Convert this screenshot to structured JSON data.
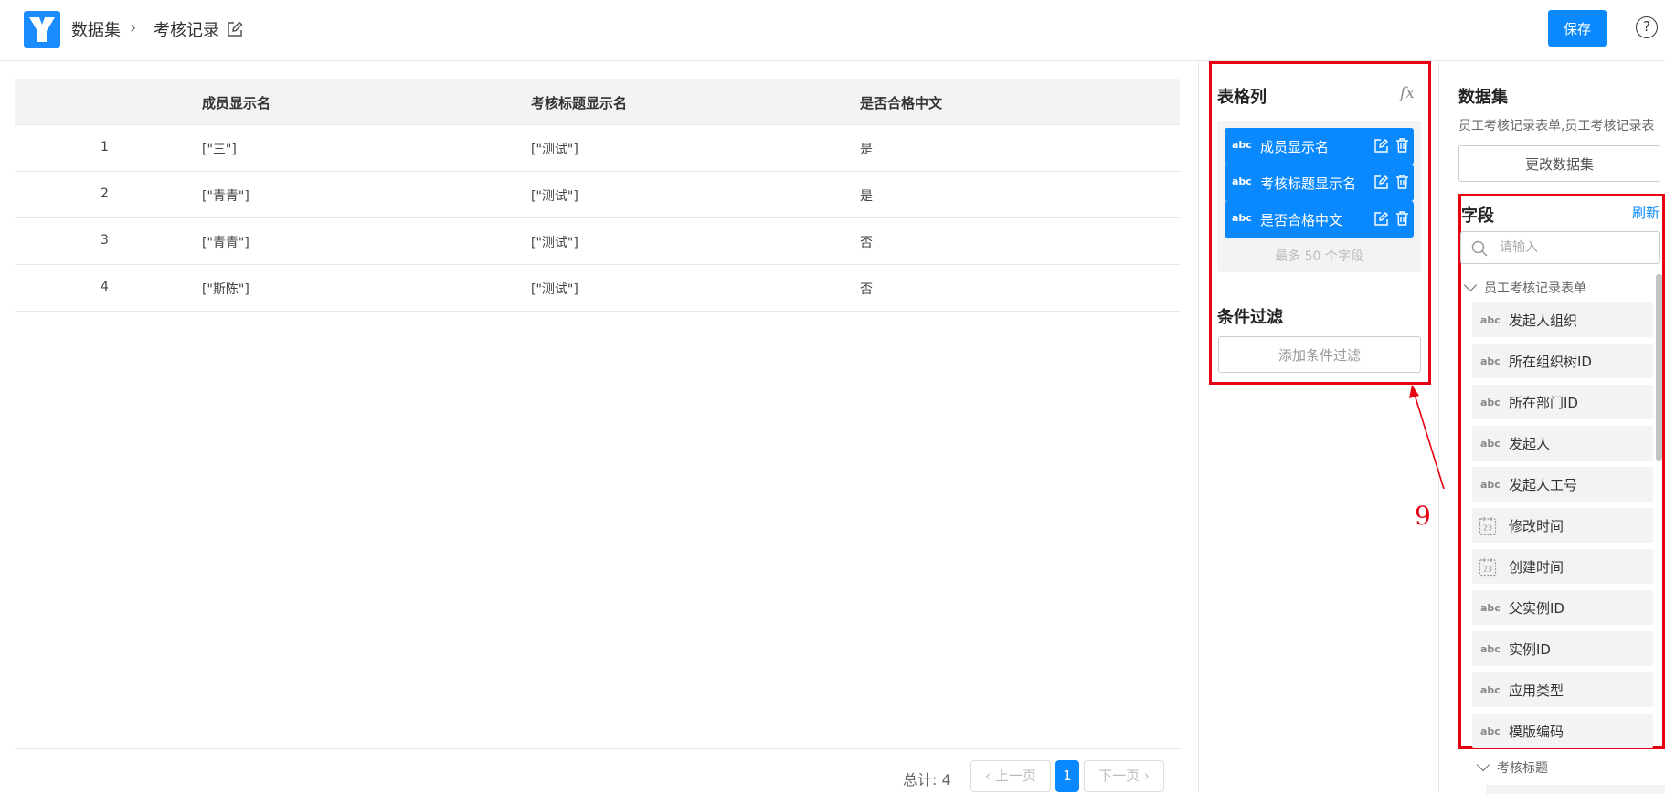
{
  "header": {
    "breadcrumb_root": "数据集",
    "breadcrumb_separator": "›",
    "breadcrumb_current": "考核记录",
    "save_label": "保存",
    "help_label": "?"
  },
  "table": {
    "headers": [
      "",
      "成员显示名",
      "考核标题显示名",
      "是否合格中文"
    ],
    "rows": [
      [
        "1",
        "[\"三\"]",
        "[\"测试\"]",
        "是"
      ],
      [
        "2",
        "[\"青青\"]",
        "[\"测试\"]",
        "是"
      ],
      [
        "3",
        "[\"青青\"]",
        "[\"测试\"]",
        "否"
      ],
      [
        "4",
        "[\"斯陈\"]",
        "[\"测试\"]",
        "否"
      ]
    ]
  },
  "pagination": {
    "total_label": "总计: 4",
    "prev_label": "上一页",
    "current_page": "1",
    "next_label": "下一页"
  },
  "columns_panel": {
    "title": "表格列",
    "fx_label": "fx",
    "columns": [
      {
        "type": "abc",
        "label": "成员显示名"
      },
      {
        "type": "abc",
        "label": "考核标题显示名"
      },
      {
        "type": "abc",
        "label": "是否合格中文"
      }
    ],
    "limit_text": "最多 50 个字段",
    "filter_title": "条件过滤",
    "add_filter_label": "添加条件过滤"
  },
  "annotation": {
    "number": "9",
    "color": "#e60012"
  },
  "dataset_panel": {
    "title": "数据集",
    "dataset_names": "员工考核记录表单,员工考核记录表",
    "change_label": "更改数据集",
    "fields_title": "字段",
    "refresh_label": "刷新",
    "search_placeholder": "请输入",
    "group1_label": "员工考核记录表单",
    "fields": [
      {
        "type": "abc",
        "label": "发起人组织"
      },
      {
        "type": "abc",
        "label": "所在组织树ID"
      },
      {
        "type": "abc",
        "label": "所在部门ID"
      },
      {
        "type": "abc",
        "label": "发起人"
      },
      {
        "type": "abc",
        "label": "发起人工号"
      },
      {
        "type": "date",
        "label": "修改时间"
      },
      {
        "type": "date",
        "label": "创建时间"
      },
      {
        "type": "abc",
        "label": "父实例ID"
      },
      {
        "type": "abc",
        "label": "实例ID"
      },
      {
        "type": "abc",
        "label": "应用类型"
      },
      {
        "type": "abc",
        "label": "模版编码"
      }
    ],
    "group2_label": "考核标题"
  },
  "colors": {
    "primary": "#0a89ff",
    "annotation_red": "#e60012",
    "header_bg": "#f2f3f5"
  }
}
